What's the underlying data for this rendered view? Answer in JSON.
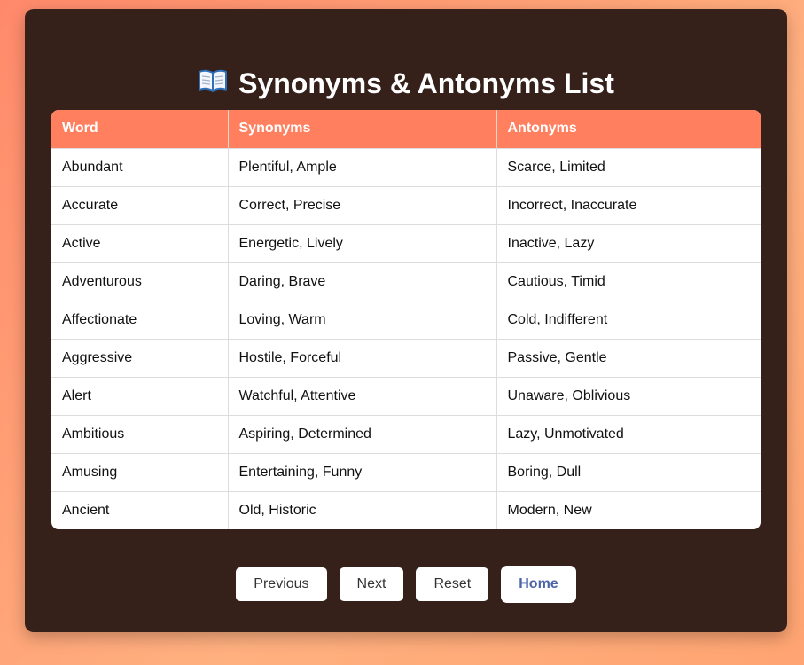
{
  "header": {
    "title": "Synonyms & Antonyms List",
    "icon": "open-book-icon"
  },
  "table": {
    "columns": [
      "Word",
      "Synonyms",
      "Antonyms"
    ],
    "rows": [
      [
        "Abundant",
        "Plentiful, Ample",
        "Scarce, Limited"
      ],
      [
        "Accurate",
        "Correct, Precise",
        "Incorrect, Inaccurate"
      ],
      [
        "Active",
        "Energetic, Lively",
        "Inactive, Lazy"
      ],
      [
        "Adventurous",
        "Daring, Brave",
        "Cautious, Timid"
      ],
      [
        "Affectionate",
        "Loving, Warm",
        "Cold, Indifferent"
      ],
      [
        "Aggressive",
        "Hostile, Forceful",
        "Passive, Gentle"
      ],
      [
        "Alert",
        "Watchful, Attentive",
        "Unaware, Oblivious"
      ],
      [
        "Ambitious",
        "Aspiring, Determined",
        "Lazy, Unmotivated"
      ],
      [
        "Amusing",
        "Entertaining, Funny",
        "Boring, Dull"
      ],
      [
        "Ancient",
        "Old, Historic",
        "Modern, New"
      ]
    ]
  },
  "buttons": {
    "previous": "Previous",
    "next": "Next",
    "reset": "Reset",
    "home": "Home"
  },
  "colors": {
    "background": "#ff9a70",
    "card": "#35201a",
    "header_row": "#ff7f5f",
    "home_text": "#4a64a8"
  }
}
